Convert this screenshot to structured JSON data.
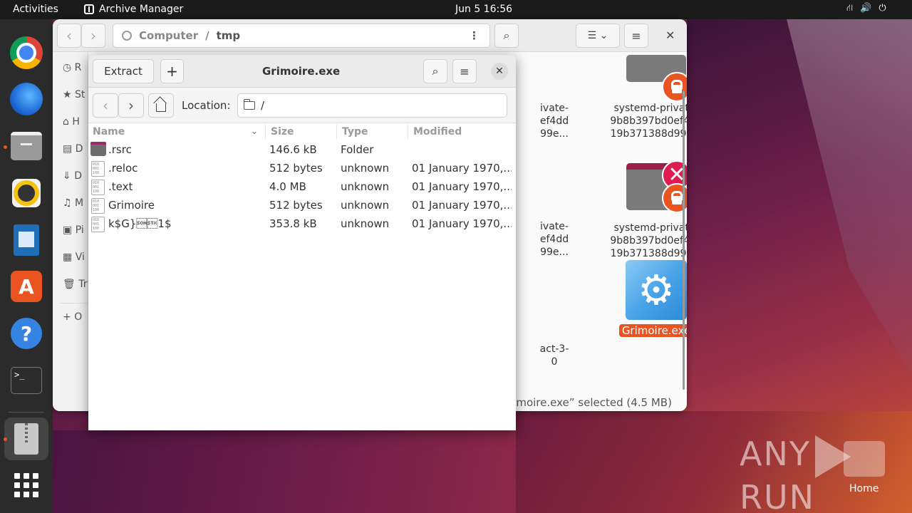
{
  "topbar": {
    "activities": "Activities",
    "app_name": "Archive Manager",
    "clock": "Jun 5  16:56",
    "tray_icons": [
      "network-icon",
      "volume-icon",
      "power-icon"
    ]
  },
  "dock": {
    "items": [
      "Google Chrome",
      "Thunderbird Mail",
      "Files",
      "Rhythmbox",
      "LibreOffice Writer",
      "Ubuntu Software",
      "Help",
      "Terminal",
      "Archive Manager",
      "Show Applications"
    ],
    "terminal_glyph": ">_"
  },
  "files_window": {
    "path": [
      "Computer",
      "tmp"
    ],
    "sidebar_labels": [
      "R",
      "St",
      "H",
      "D",
      "D",
      "M",
      "Pi",
      "Vi",
      "Tr",
      "O"
    ],
    "icons": [
      {
        "label_lines": [
          "ivate-",
          "ef4dd",
          "99e..."
        ]
      },
      {
        "label_lines": [
          "systemd-private-",
          "9b8b397bd0ef4dd",
          "19b371388d99e..."
        ]
      },
      {
        "label_lines": [
          "ivate-",
          "ef4dd",
          "99e..."
        ]
      },
      {
        "label_lines": [
          "systemd-private-",
          "9b8b397bd0ef4dd",
          "19b371388d99e..."
        ]
      },
      {
        "label_lines": [
          "act-3-",
          "0"
        ]
      },
      {
        "label": "Grimoire.exe"
      }
    ],
    "status": "rimoire.exe” selected  (4.5 MB)"
  },
  "archive_window": {
    "extract_label": "Extract",
    "add_glyph": "+",
    "title": "Grimoire.exe",
    "location_label": "Location:",
    "location_value": "/",
    "columns": [
      "Name",
      "Size",
      "Type",
      "Modified"
    ],
    "rows": [
      {
        "name": ".rsrc",
        "size": "146.6 kB",
        "type": "Folder",
        "modified": "",
        "icon": "folder-icon"
      },
      {
        "name": ".reloc",
        "size": "512 bytes",
        "type": "unknown",
        "modified": "01 January 1970,...",
        "icon": "binary-file-icon"
      },
      {
        "name": ".text",
        "size": "4.0 MB",
        "type": "unknown",
        "modified": "01 January 1970,...",
        "icon": "binary-file-icon"
      },
      {
        "name": "Grimoire",
        "size": "512 bytes",
        "type": "unknown",
        "modified": "01 January 1970,...",
        "icon": "binary-file-icon"
      },
      {
        "name": "k$G}\u0001\u00021$",
        "size": "353.8 kB",
        "type": "unknown",
        "modified": "01 January 1970,...",
        "icon": "binary-file-icon"
      }
    ]
  },
  "watermark": {
    "text_left": "ANY",
    "text_right": "RUN"
  },
  "desktop": {
    "home_label": "Home"
  },
  "colors": {
    "accent": "#e95420",
    "topbar": "#1a1a1a",
    "dock": "#2b2b2b"
  }
}
